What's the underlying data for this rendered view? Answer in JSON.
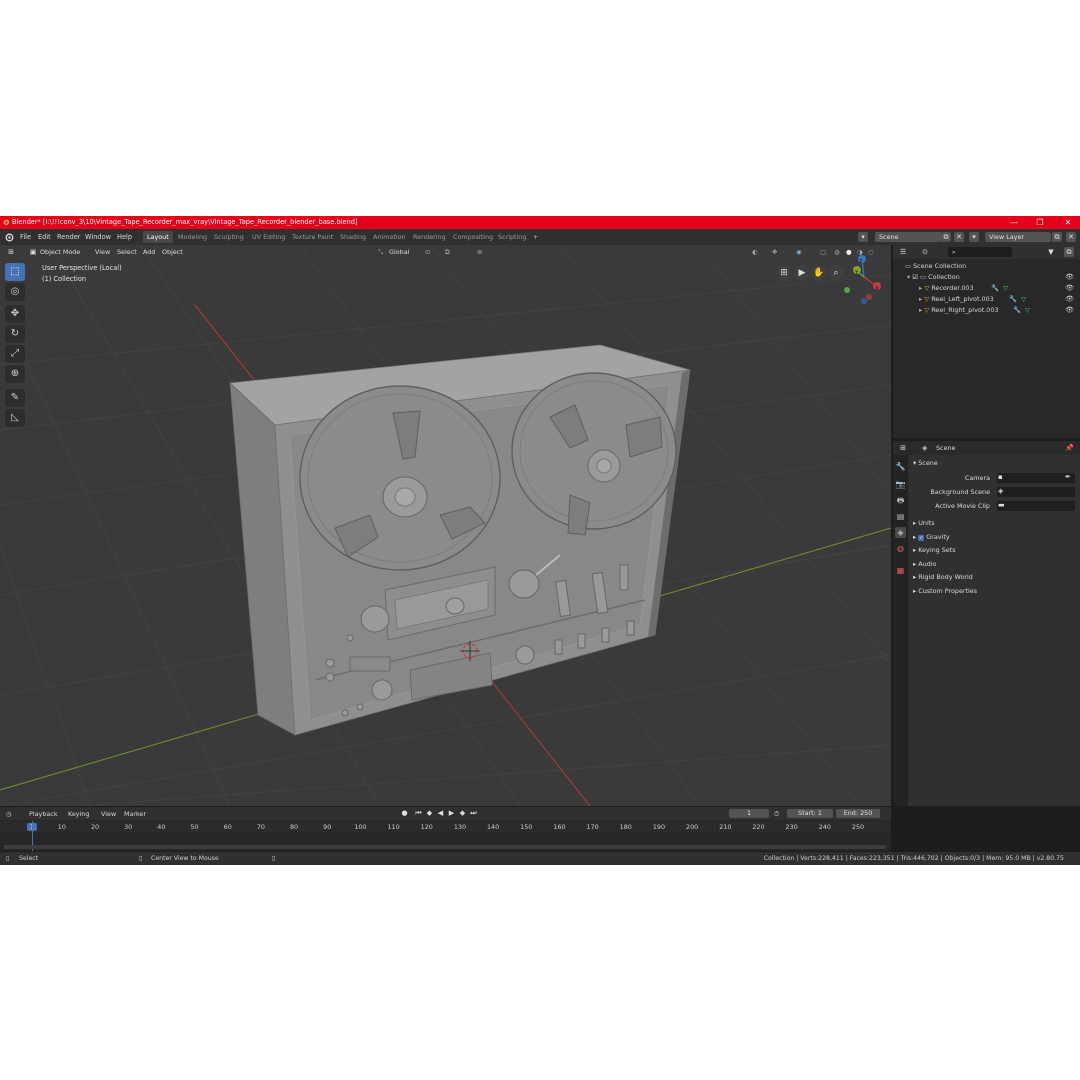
{
  "titlebar": {
    "title": "Blender* [I:\\!!!conv_3\\10\\Vintage_Tape_Recorder_max_vray\\Vintage_Tape_Recorder_blender_base.blend]",
    "minimize": "—",
    "maximize": "❐",
    "close": "✕"
  },
  "menu": {
    "items": [
      "File",
      "Edit",
      "Render",
      "Window",
      "Help"
    ]
  },
  "workspaces": [
    "Layout",
    "Modeling",
    "Sculpting",
    "UV Editing",
    "Texture Paint",
    "Shading",
    "Animation",
    "Rendering",
    "Compositing",
    "Scripting"
  ],
  "workspace_add": "+",
  "scene_field": "Scene",
  "view_layer_field": "View Layer",
  "viewport": {
    "mode": "Object Mode",
    "menus": [
      "View",
      "Select",
      "Add",
      "Object"
    ],
    "transform_orientation": "Global",
    "info_line1": "User Perspective (Local)",
    "info_line2": "(1) Collection",
    "gizmo_labels": {
      "x": "X",
      "y": "Y",
      "z": "Z"
    }
  },
  "toolbar_icons": [
    "select-box-icon",
    "cursor-icon",
    "move-icon",
    "rotate-icon",
    "scale-icon",
    "transform-icon",
    "annotate-icon",
    "measure-icon"
  ],
  "outliner": {
    "root": "Scene Collection",
    "collection": "Collection",
    "objects": [
      "Recorder.003",
      "Reel_Left_pivot.003",
      "Reel_Right_pivot.003"
    ]
  },
  "properties": {
    "header": "Scene",
    "section": "Scene",
    "camera_label": "Camera",
    "background_label": "Background Scene",
    "movie_clip_label": "Active Movie Clip",
    "panels": [
      "Units",
      "Gravity",
      "Keying Sets",
      "Audio",
      "Rigid Body World",
      "Custom Properties"
    ],
    "gravity_checked": true
  },
  "timeline": {
    "menus": [
      "Playback",
      "Keying",
      "View",
      "Marker"
    ],
    "current_frame": "1",
    "start_label": "Start:",
    "start": "1",
    "end_label": "End:",
    "end": "250",
    "ticks": [
      "1",
      "10",
      "20",
      "30",
      "40",
      "50",
      "60",
      "70",
      "80",
      "90",
      "100",
      "110",
      "120",
      "130",
      "140",
      "150",
      "160",
      "170",
      "180",
      "190",
      "200",
      "210",
      "220",
      "230",
      "240",
      "250"
    ]
  },
  "status": {
    "select": "Select",
    "center": "Center View to Mouse",
    "stats": "Collection | Verts:228,411 | Faces:223,351 | Tris:446,702 | Objects:0/3 | Mem: 95.0 MB | v2.80.75"
  },
  "colors": {
    "titlebar": "#e4001b",
    "accent": "#4772b3",
    "viewport_bg": "#3a3a3a",
    "x_axis": "#c43c3c",
    "y_axis": "#7ea22c"
  }
}
